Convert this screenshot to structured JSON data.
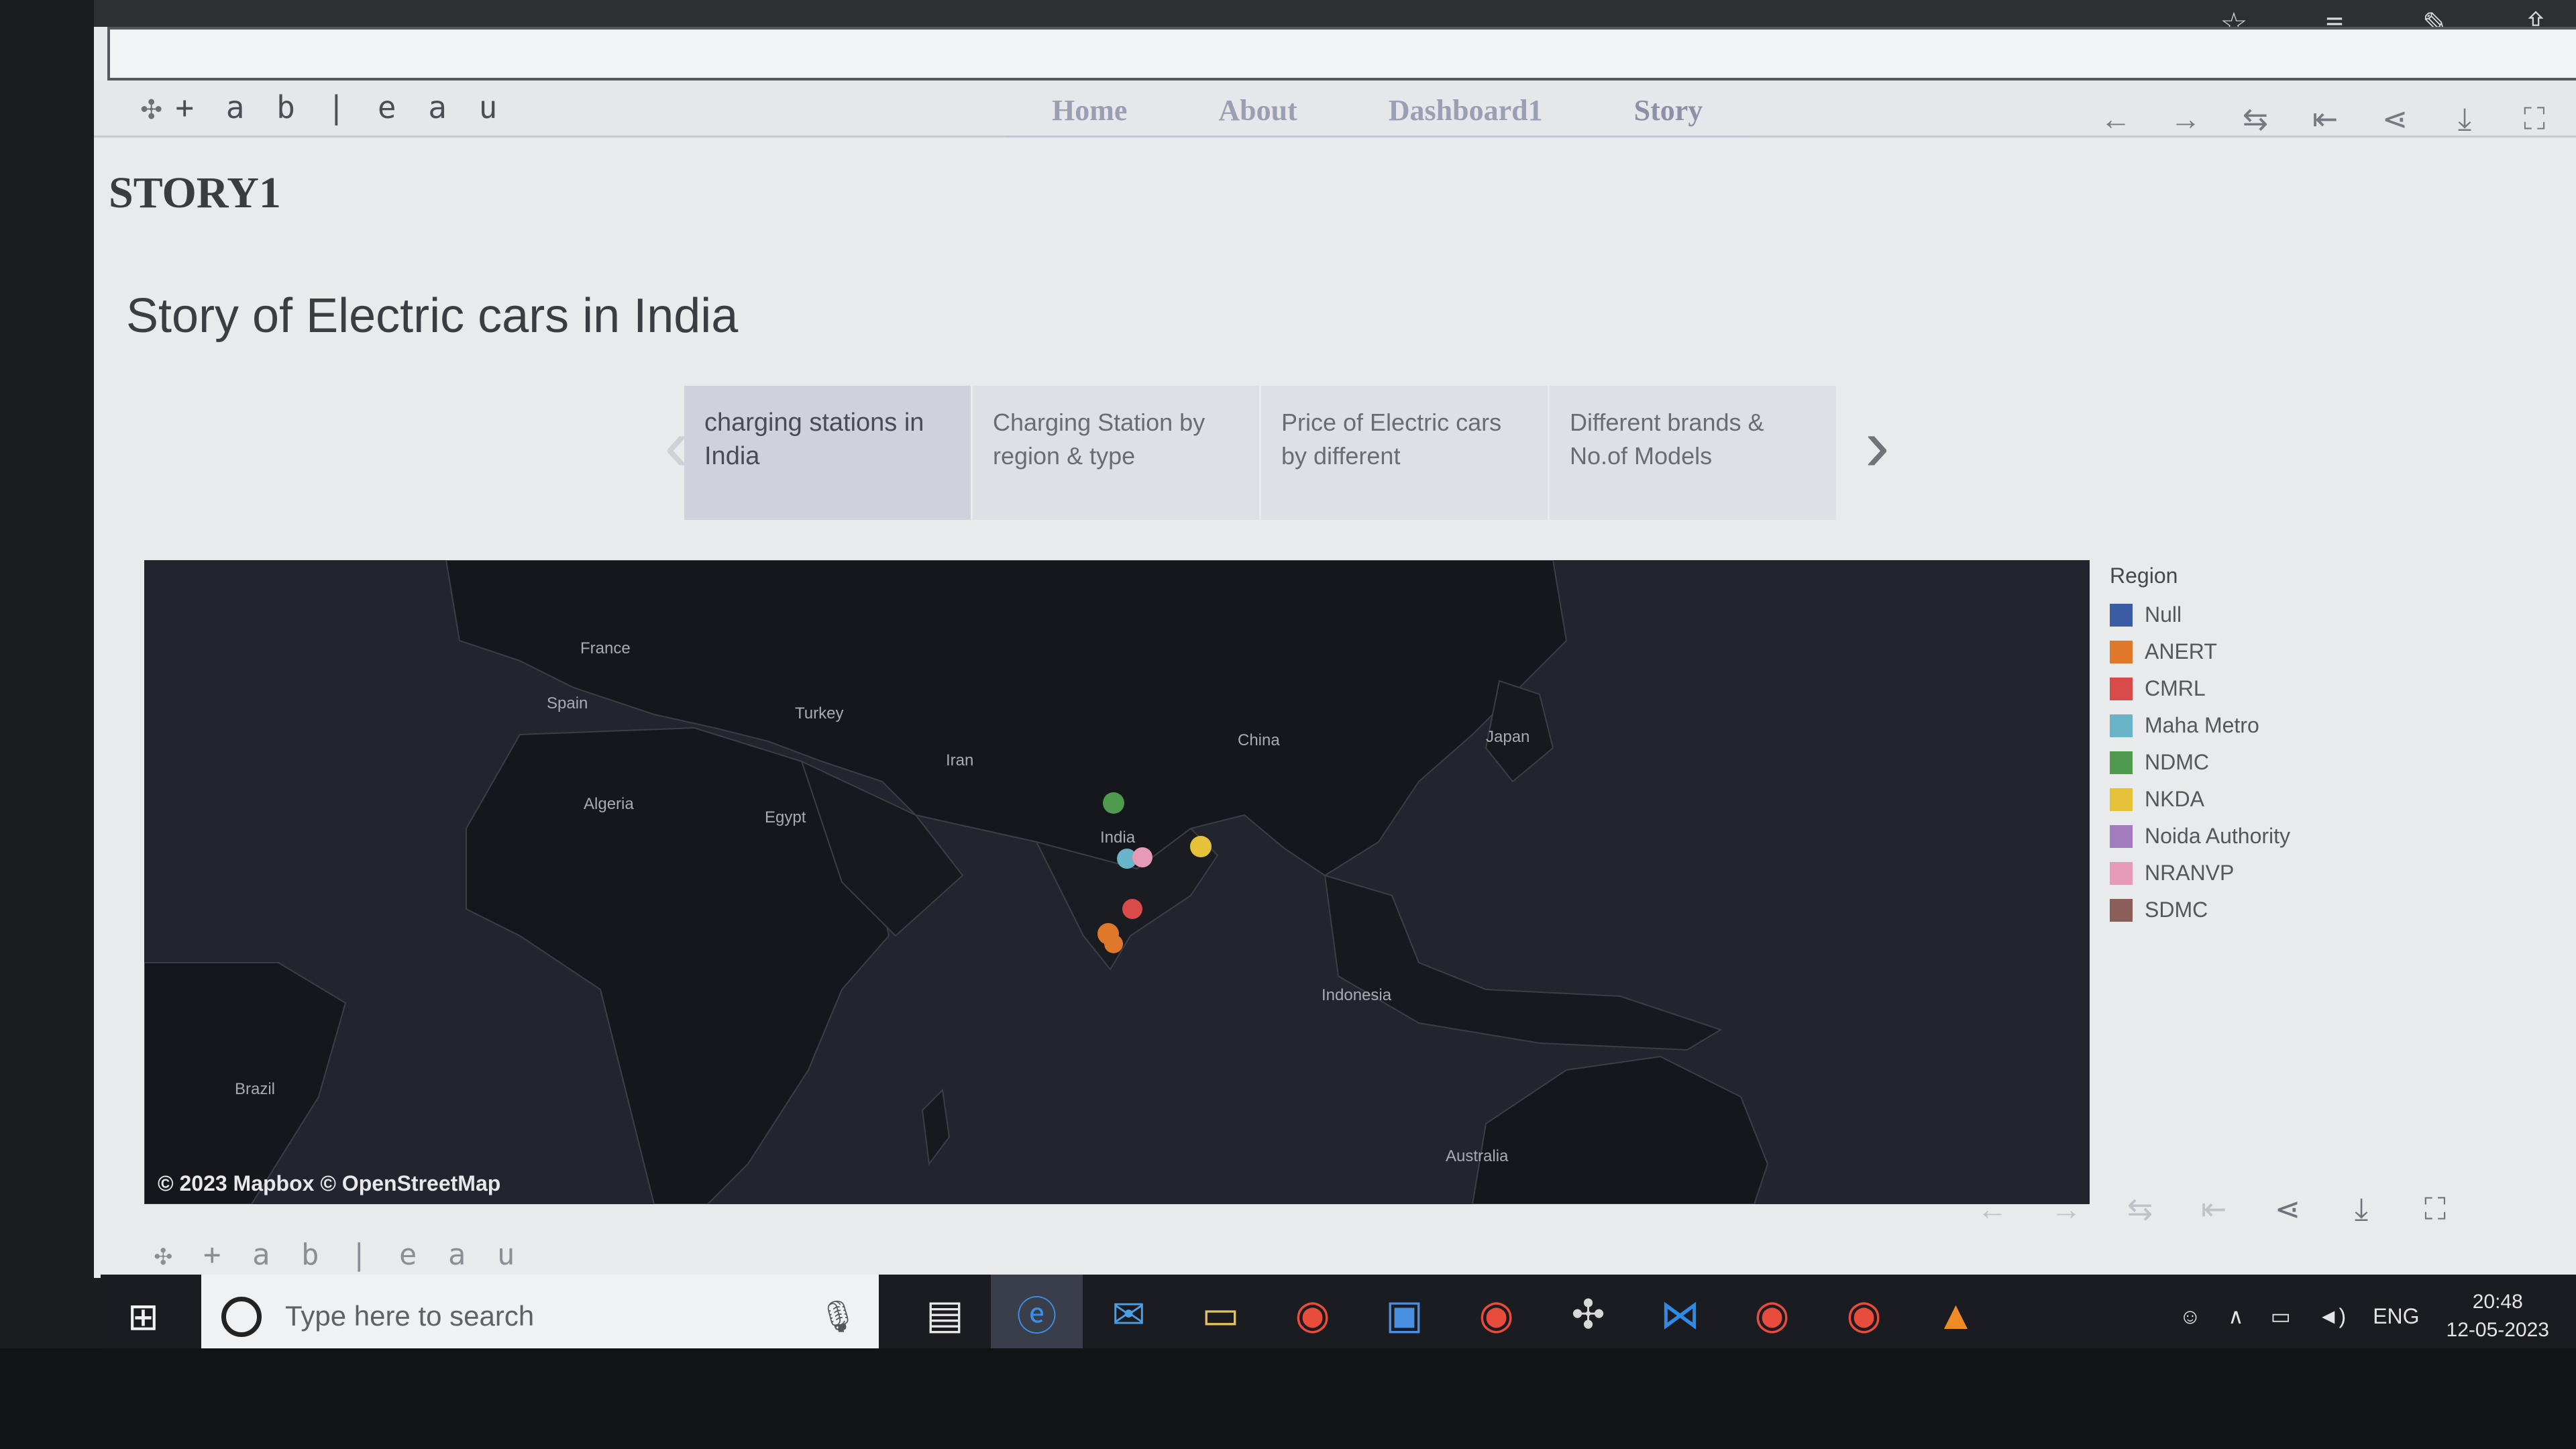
{
  "browser": {
    "icons": [
      "star-icon",
      "favorites-icon",
      "pen-icon",
      "share-icon"
    ]
  },
  "tableau": {
    "logo_text": "+ a b | e a u",
    "nav": [
      "Home",
      "About",
      "Dashboard1",
      "Story"
    ],
    "toolbar_icons": [
      "undo-icon",
      "redo-icon",
      "revert-icon",
      "reset-icon",
      "share-icon",
      "download-icon",
      "fullscreen-icon"
    ]
  },
  "story": {
    "label": "STORY1",
    "title": "Story of Electric cars in India",
    "points": [
      "charging stations in India",
      "Charging Station by region & type",
      "Price of Electric cars by different",
      "Different brands & No.of Models"
    ]
  },
  "map": {
    "labels": [
      "France",
      "Spain",
      "Turkey",
      "Algeria",
      "Egypt",
      "Iran",
      "India",
      "China",
      "Japan",
      "Indonesia",
      "Brazil",
      "Australia"
    ],
    "credit": "© 2023 Mapbox © OpenStreetMap"
  },
  "legend": {
    "title": "Region",
    "items": [
      {
        "label": "Null",
        "color": "#3b5ba5"
      },
      {
        "label": "ANERT",
        "color": "#e0782c"
      },
      {
        "label": "CMRL",
        "color": "#d94b4b"
      },
      {
        "label": "Maha Metro",
        "color": "#6ab4c9"
      },
      {
        "label": "NDMC",
        "color": "#4f9a4f"
      },
      {
        "label": "NKDA",
        "color": "#e6c23a"
      },
      {
        "label": "Noida Authority",
        "color": "#a37cc0"
      },
      {
        "label": "NRANVP",
        "color": "#e79ab5"
      },
      {
        "label": "SDMC",
        "color": "#8b5e5a"
      }
    ]
  },
  "taskbar": {
    "search_placeholder": "Type here to search",
    "language": "ENG",
    "time": "20:48",
    "date": "12-05-2023"
  }
}
